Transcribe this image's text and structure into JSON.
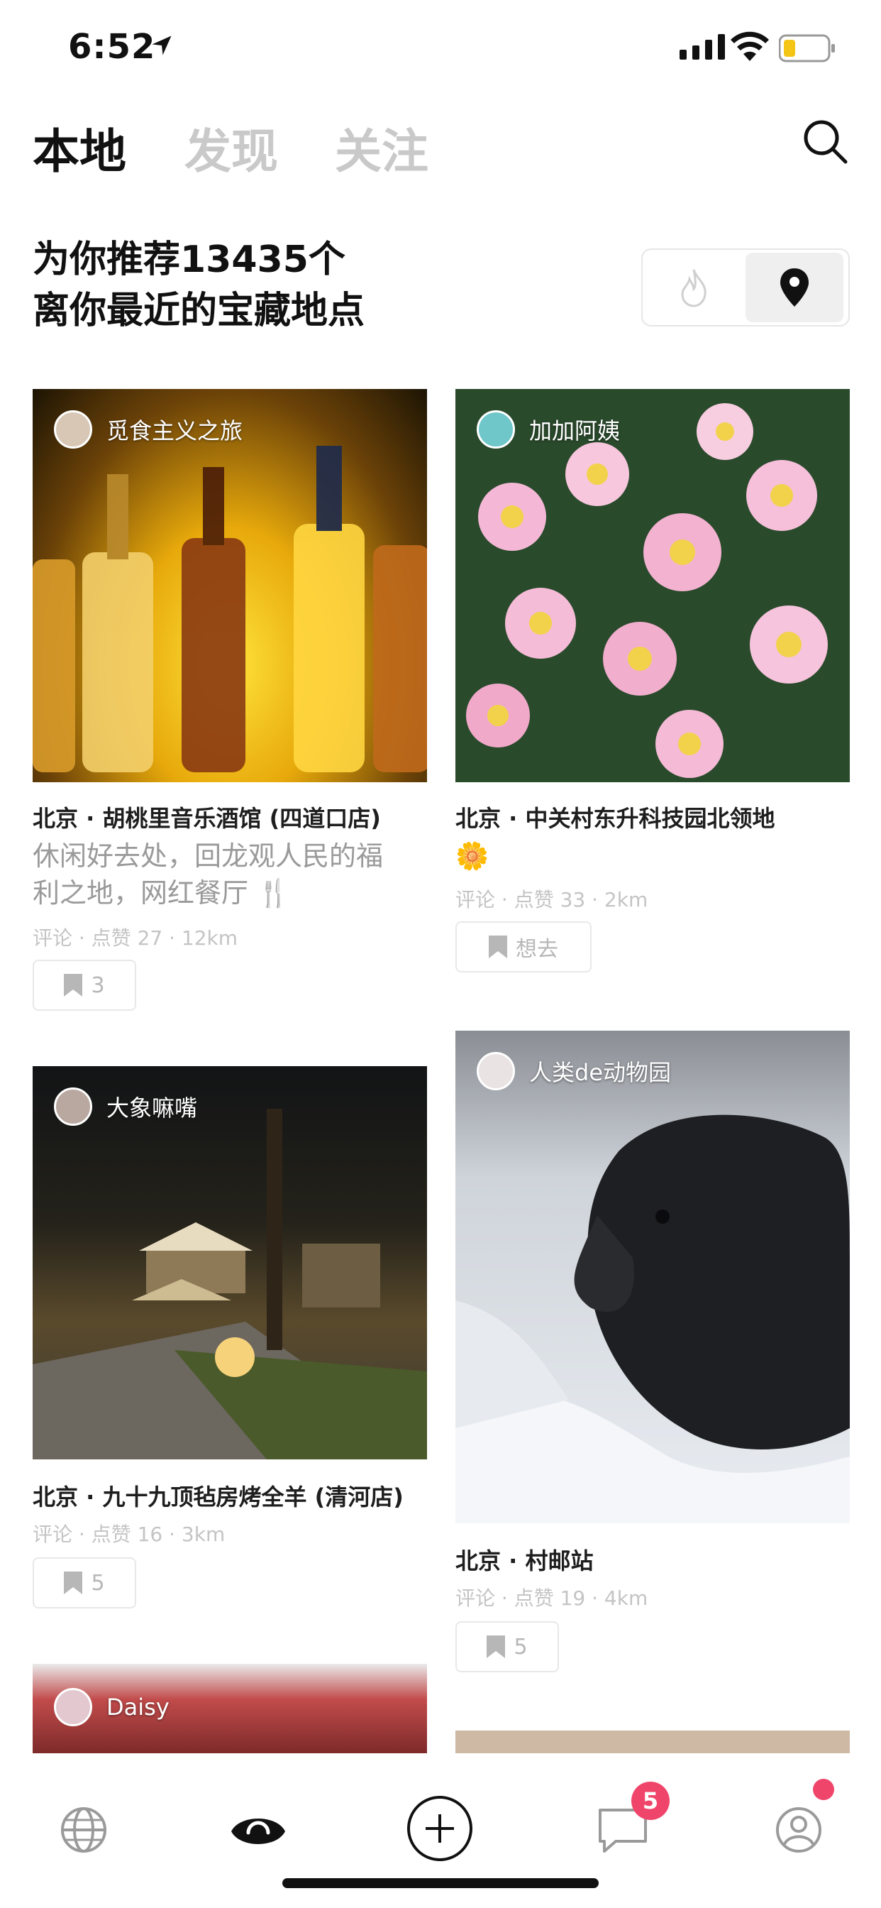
{
  "status": {
    "time": "6:52"
  },
  "tabs": {
    "local": "本地",
    "discover": "发现",
    "follow": "关注"
  },
  "headline": {
    "line1": "为你推荐13435个",
    "line2": "离你最近的宝藏地点"
  },
  "colors": {
    "accent": "#f0456b",
    "inactive_tab": "#c9c9c9",
    "meta": "#c4c4c4"
  },
  "cards": [
    {
      "author": "觅食主义之旅",
      "place": "北京 · 胡桃里音乐酒馆 (四道口店)",
      "desc_line1": "休闲好去处，回龙观人民的福",
      "desc_line2": "利之地，网红餐厅 🍴",
      "meta": "评论 · 点赞 27 · 12km",
      "saves": "3"
    },
    {
      "author": "加加阿姨",
      "place": "北京 · 中关村东升科技园北领地",
      "desc_line1": "🌼",
      "meta": "评论 · 点赞 33 · 2km",
      "save_label": "想去"
    },
    {
      "author": "大象嘛嘴",
      "place": "北京 · 九十九顶毡房烤全羊 (清河店)",
      "meta": "评论 · 点赞 16 · 3km",
      "saves": "5"
    },
    {
      "author": "人类de动物园",
      "place": "北京 · 村邮站",
      "meta": "评论 · 点赞 19 · 4km",
      "saves": "5"
    },
    {
      "author": "Daisy"
    }
  ],
  "nav": {
    "items": [
      "globe-icon",
      "eye-icon",
      "plus-icon",
      "message-icon",
      "profile-icon"
    ],
    "message_badge": "5"
  }
}
